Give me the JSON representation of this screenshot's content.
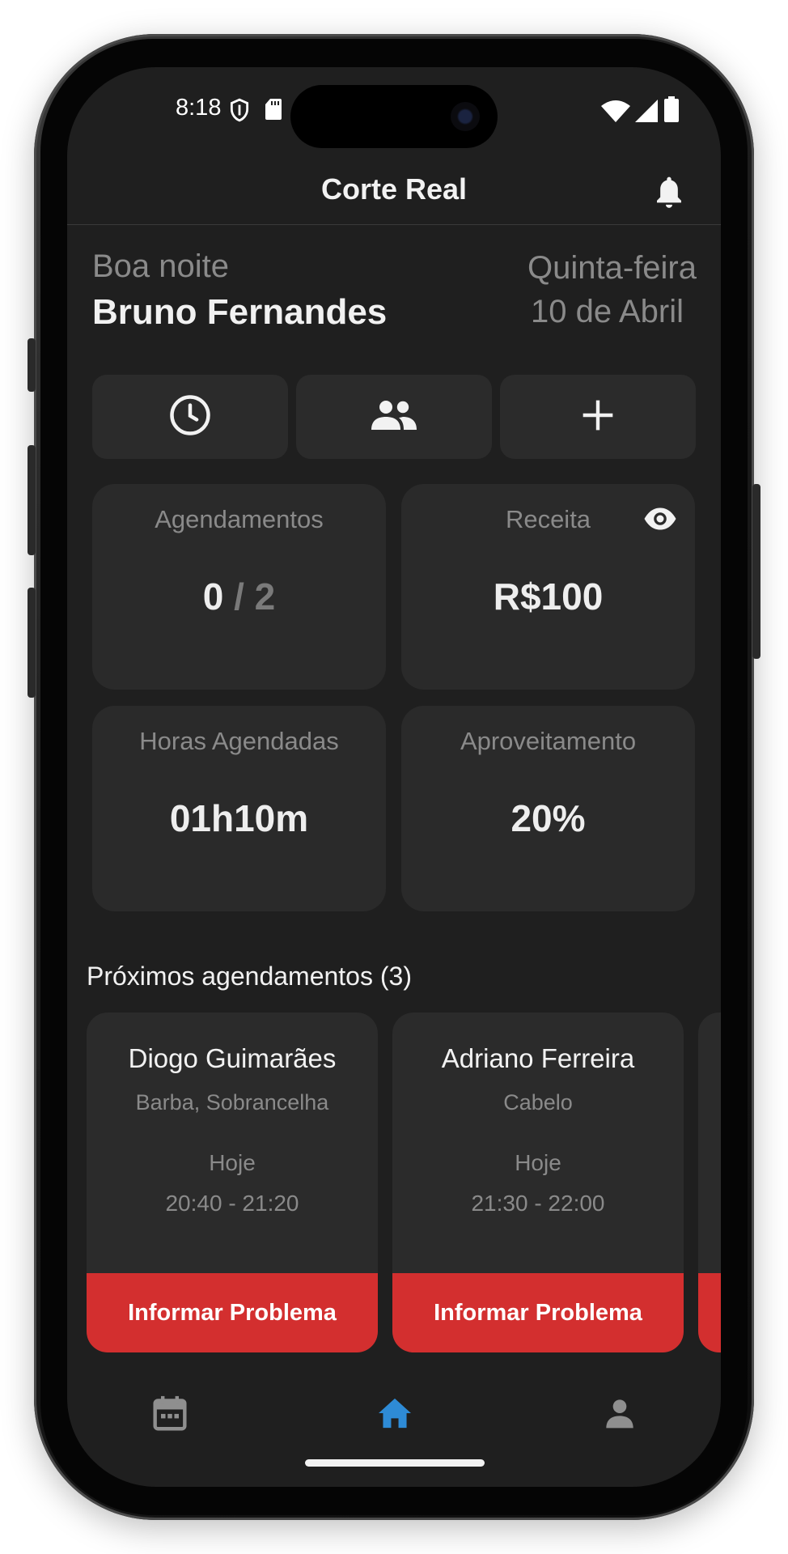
{
  "status_bar": {
    "time": "8:18",
    "icons": [
      "shield-icon",
      "sd-card-icon",
      "wifi-icon",
      "signal-icon",
      "battery-icon"
    ]
  },
  "header": {
    "title": "Corte Real",
    "action_icon": "bell-icon"
  },
  "greeting": {
    "salutation": "Boa noite",
    "name": "Bruno Fernandes"
  },
  "date": {
    "weekday": "Quinta-feira",
    "day": "10 de Abril"
  },
  "quick_actions": [
    {
      "icon": "clock-icon"
    },
    {
      "icon": "people-icon"
    },
    {
      "icon": "plus-icon"
    }
  ],
  "stats": {
    "appointments": {
      "label": "Agendamentos",
      "done": "0",
      "separator": "/",
      "total": "2"
    },
    "revenue": {
      "label": "Receita",
      "value": "R$100",
      "icon": "eye-icon"
    },
    "hours": {
      "label": "Horas Agendadas",
      "value": "01h10m"
    },
    "utilization": {
      "label": "Aproveitamento",
      "value": "20%"
    }
  },
  "upcoming": {
    "title": "Próximos agendamentos (3)",
    "items": [
      {
        "name": "Diogo Guimarães",
        "service": "Barba, Sobrancelha",
        "day": "Hoje",
        "time": "20:40 - 21:20",
        "action": "Informar Problema"
      },
      {
        "name": "Adriano Ferreira",
        "service": "Cabelo",
        "day": "Hoje",
        "time": "21:30 - 22:00",
        "action": "Informar Problema"
      }
    ]
  },
  "bottom_nav": [
    {
      "icon": "calendar-icon",
      "active": false
    },
    {
      "icon": "home-icon",
      "active": true
    },
    {
      "icon": "person-icon",
      "active": false
    }
  ],
  "colors": {
    "background": "#1f1f1f",
    "card": "#2a2a2a",
    "accent": "#2e8bd6",
    "danger": "#d32f2f",
    "muted_text": "#8a8a8a"
  }
}
